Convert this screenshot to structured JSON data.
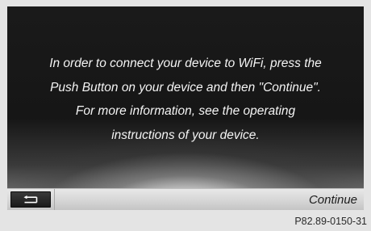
{
  "screen": {
    "message_lines": [
      "In order to connect your device to WiFi, press the",
      "Push Button on your device and then \"Continue\".",
      "For more information, see the operating",
      "instructions of your device."
    ]
  },
  "bottom_bar": {
    "back_icon": "back-arrow-icon",
    "continue_label": "Continue"
  },
  "figure_ref": "P82.89-0150-31",
  "colors": {
    "screen_background": "#161616",
    "message_text": "#f4f4f4",
    "bar_background": "#d4d4d4",
    "back_button": "#1a1a1a"
  }
}
